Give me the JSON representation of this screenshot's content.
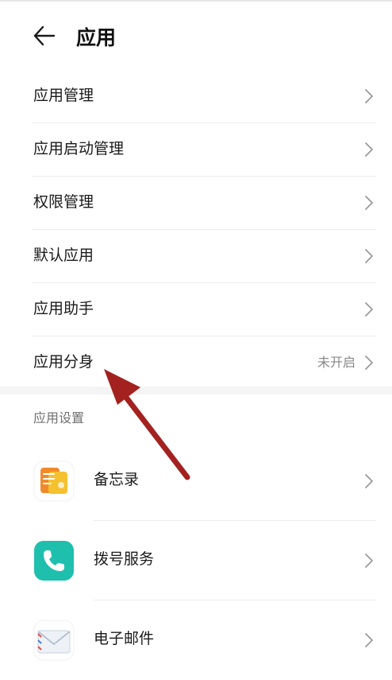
{
  "header": {
    "title": "应用",
    "back_icon": "arrow-left-icon"
  },
  "menu": [
    {
      "label": "应用管理",
      "value": ""
    },
    {
      "label": "应用启动管理",
      "value": ""
    },
    {
      "label": "权限管理",
      "value": ""
    },
    {
      "label": "默认应用",
      "value": ""
    },
    {
      "label": "应用助手",
      "value": ""
    },
    {
      "label": "应用分身",
      "value": "未开启"
    }
  ],
  "app_settings": {
    "section_title": "应用设置",
    "apps": [
      {
        "label": "备忘录",
        "icon": "notepad-icon"
      },
      {
        "label": "拨号服务",
        "icon": "phone-icon"
      },
      {
        "label": "电子邮件",
        "icon": "email-icon"
      }
    ]
  },
  "colors": {
    "annotation_arrow": "#a3221f",
    "notepad_orange": "#f08a2a",
    "notepad_yellow": "#f6c12f",
    "phone_teal": "#1fbfae",
    "chevron": "#9a9a9a"
  }
}
